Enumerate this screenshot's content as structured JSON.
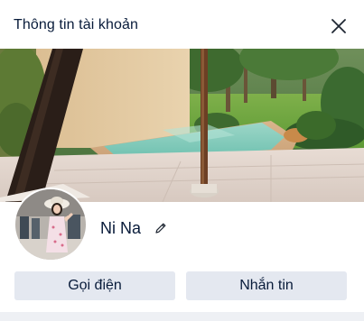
{
  "dialog": {
    "title": "Thông tin tài khoản"
  },
  "profile": {
    "name": "Ni Na"
  },
  "actions": {
    "call_label": "Gọi điện",
    "message_label": "Nhắn tin"
  },
  "icons": {
    "close": "close-icon",
    "edit": "pencil-icon"
  },
  "colors": {
    "text": "#081b3a",
    "button_bg": "#e4e8f0"
  }
}
